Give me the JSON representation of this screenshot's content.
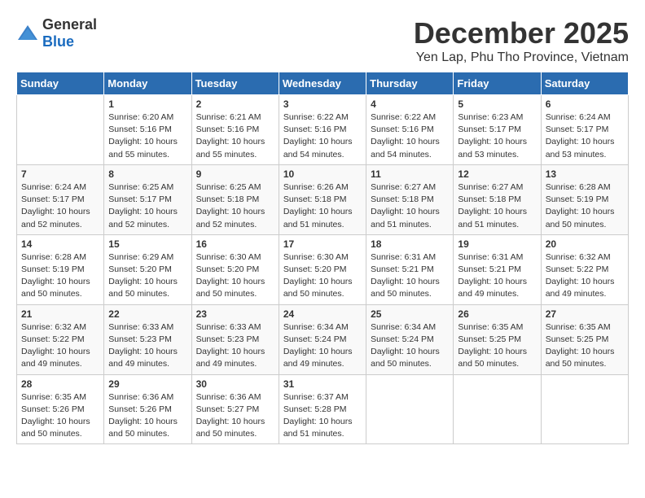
{
  "logo": {
    "general": "General",
    "blue": "Blue"
  },
  "header": {
    "month_year": "December 2025",
    "location": "Yen Lap, Phu Tho Province, Vietnam"
  },
  "weekdays": [
    "Sunday",
    "Monday",
    "Tuesday",
    "Wednesday",
    "Thursday",
    "Friday",
    "Saturday"
  ],
  "weeks": [
    [
      {
        "day": "",
        "sunrise": "",
        "sunset": "",
        "daylight": ""
      },
      {
        "day": "1",
        "sunrise": "Sunrise: 6:20 AM",
        "sunset": "Sunset: 5:16 PM",
        "daylight": "Daylight: 10 hours and 55 minutes."
      },
      {
        "day": "2",
        "sunrise": "Sunrise: 6:21 AM",
        "sunset": "Sunset: 5:16 PM",
        "daylight": "Daylight: 10 hours and 55 minutes."
      },
      {
        "day": "3",
        "sunrise": "Sunrise: 6:22 AM",
        "sunset": "Sunset: 5:16 PM",
        "daylight": "Daylight: 10 hours and 54 minutes."
      },
      {
        "day": "4",
        "sunrise": "Sunrise: 6:22 AM",
        "sunset": "Sunset: 5:16 PM",
        "daylight": "Daylight: 10 hours and 54 minutes."
      },
      {
        "day": "5",
        "sunrise": "Sunrise: 6:23 AM",
        "sunset": "Sunset: 5:17 PM",
        "daylight": "Daylight: 10 hours and 53 minutes."
      },
      {
        "day": "6",
        "sunrise": "Sunrise: 6:24 AM",
        "sunset": "Sunset: 5:17 PM",
        "daylight": "Daylight: 10 hours and 53 minutes."
      }
    ],
    [
      {
        "day": "7",
        "sunrise": "Sunrise: 6:24 AM",
        "sunset": "Sunset: 5:17 PM",
        "daylight": "Daylight: 10 hours and 52 minutes."
      },
      {
        "day": "8",
        "sunrise": "Sunrise: 6:25 AM",
        "sunset": "Sunset: 5:17 PM",
        "daylight": "Daylight: 10 hours and 52 minutes."
      },
      {
        "day": "9",
        "sunrise": "Sunrise: 6:25 AM",
        "sunset": "Sunset: 5:18 PM",
        "daylight": "Daylight: 10 hours and 52 minutes."
      },
      {
        "day": "10",
        "sunrise": "Sunrise: 6:26 AM",
        "sunset": "Sunset: 5:18 PM",
        "daylight": "Daylight: 10 hours and 51 minutes."
      },
      {
        "day": "11",
        "sunrise": "Sunrise: 6:27 AM",
        "sunset": "Sunset: 5:18 PM",
        "daylight": "Daylight: 10 hours and 51 minutes."
      },
      {
        "day": "12",
        "sunrise": "Sunrise: 6:27 AM",
        "sunset": "Sunset: 5:18 PM",
        "daylight": "Daylight: 10 hours and 51 minutes."
      },
      {
        "day": "13",
        "sunrise": "Sunrise: 6:28 AM",
        "sunset": "Sunset: 5:19 PM",
        "daylight": "Daylight: 10 hours and 50 minutes."
      }
    ],
    [
      {
        "day": "14",
        "sunrise": "Sunrise: 6:28 AM",
        "sunset": "Sunset: 5:19 PM",
        "daylight": "Daylight: 10 hours and 50 minutes."
      },
      {
        "day": "15",
        "sunrise": "Sunrise: 6:29 AM",
        "sunset": "Sunset: 5:20 PM",
        "daylight": "Daylight: 10 hours and 50 minutes."
      },
      {
        "day": "16",
        "sunrise": "Sunrise: 6:30 AM",
        "sunset": "Sunset: 5:20 PM",
        "daylight": "Daylight: 10 hours and 50 minutes."
      },
      {
        "day": "17",
        "sunrise": "Sunrise: 6:30 AM",
        "sunset": "Sunset: 5:20 PM",
        "daylight": "Daylight: 10 hours and 50 minutes."
      },
      {
        "day": "18",
        "sunrise": "Sunrise: 6:31 AM",
        "sunset": "Sunset: 5:21 PM",
        "daylight": "Daylight: 10 hours and 50 minutes."
      },
      {
        "day": "19",
        "sunrise": "Sunrise: 6:31 AM",
        "sunset": "Sunset: 5:21 PM",
        "daylight": "Daylight: 10 hours and 49 minutes."
      },
      {
        "day": "20",
        "sunrise": "Sunrise: 6:32 AM",
        "sunset": "Sunset: 5:22 PM",
        "daylight": "Daylight: 10 hours and 49 minutes."
      }
    ],
    [
      {
        "day": "21",
        "sunrise": "Sunrise: 6:32 AM",
        "sunset": "Sunset: 5:22 PM",
        "daylight": "Daylight: 10 hours and 49 minutes."
      },
      {
        "day": "22",
        "sunrise": "Sunrise: 6:33 AM",
        "sunset": "Sunset: 5:23 PM",
        "daylight": "Daylight: 10 hours and 49 minutes."
      },
      {
        "day": "23",
        "sunrise": "Sunrise: 6:33 AM",
        "sunset": "Sunset: 5:23 PM",
        "daylight": "Daylight: 10 hours and 49 minutes."
      },
      {
        "day": "24",
        "sunrise": "Sunrise: 6:34 AM",
        "sunset": "Sunset: 5:24 PM",
        "daylight": "Daylight: 10 hours and 49 minutes."
      },
      {
        "day": "25",
        "sunrise": "Sunrise: 6:34 AM",
        "sunset": "Sunset: 5:24 PM",
        "daylight": "Daylight: 10 hours and 50 minutes."
      },
      {
        "day": "26",
        "sunrise": "Sunrise: 6:35 AM",
        "sunset": "Sunset: 5:25 PM",
        "daylight": "Daylight: 10 hours and 50 minutes."
      },
      {
        "day": "27",
        "sunrise": "Sunrise: 6:35 AM",
        "sunset": "Sunset: 5:25 PM",
        "daylight": "Daylight: 10 hours and 50 minutes."
      }
    ],
    [
      {
        "day": "28",
        "sunrise": "Sunrise: 6:35 AM",
        "sunset": "Sunset: 5:26 PM",
        "daylight": "Daylight: 10 hours and 50 minutes."
      },
      {
        "day": "29",
        "sunrise": "Sunrise: 6:36 AM",
        "sunset": "Sunset: 5:26 PM",
        "daylight": "Daylight: 10 hours and 50 minutes."
      },
      {
        "day": "30",
        "sunrise": "Sunrise: 6:36 AM",
        "sunset": "Sunset: 5:27 PM",
        "daylight": "Daylight: 10 hours and 50 minutes."
      },
      {
        "day": "31",
        "sunrise": "Sunrise: 6:37 AM",
        "sunset": "Sunset: 5:28 PM",
        "daylight": "Daylight: 10 hours and 51 minutes."
      },
      {
        "day": "",
        "sunrise": "",
        "sunset": "",
        "daylight": ""
      },
      {
        "day": "",
        "sunrise": "",
        "sunset": "",
        "daylight": ""
      },
      {
        "day": "",
        "sunrise": "",
        "sunset": "",
        "daylight": ""
      }
    ]
  ]
}
